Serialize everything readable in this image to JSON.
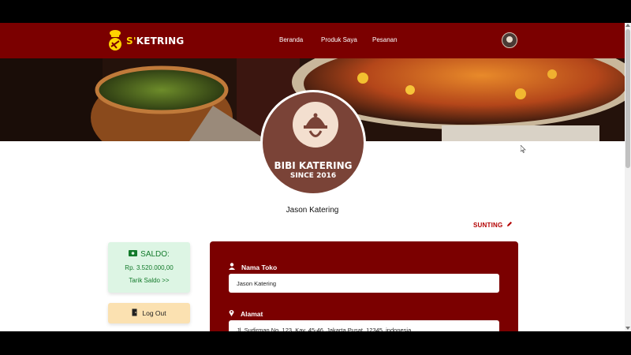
{
  "navbar": {
    "brand_mark": "S'",
    "brand_rest": "KETRING",
    "links": [
      "Beranda",
      "Produk Saya",
      "Pesanan"
    ],
    "avatar_icon": "shop-avatar-icon"
  },
  "hero": {
    "image": "food-banner-image"
  },
  "shop": {
    "logo_line1": "BIBI KATERING",
    "logo_line2": "SINCE 2016",
    "name": "Jason Katering"
  },
  "edit": {
    "label": "SUNTING",
    "icon": "pencil-icon"
  },
  "saldo": {
    "title": "SALDO:",
    "value": "Rp. 3.520.000,00",
    "link": "Tarik Saldo >>",
    "icon": "money-icon"
  },
  "logout": {
    "label": "Log Out",
    "icon": "door-icon"
  },
  "form": {
    "fields": [
      {
        "label": "Nama Toko",
        "value": "Jason Katering",
        "icon": "user-icon"
      },
      {
        "label": "Alamat",
        "value": "Jl. Sudirman No. 123, Kav. 45-46, Jakarta Pusat, 12345, indonesia",
        "icon": "location-pin-icon"
      }
    ]
  },
  "colors": {
    "primary": "#7b0000",
    "brand_yellow": "#ffd400",
    "saldo_bg": "#ddf5e4",
    "saldo_text": "#137a2b",
    "logout_bg": "#fbe1b1",
    "edit_red": "#b30000"
  }
}
